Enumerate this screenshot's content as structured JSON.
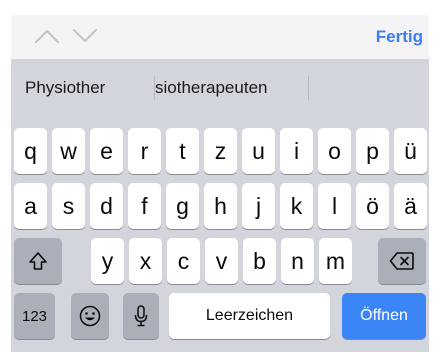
{
  "toolbar": {
    "prev_icon": "chevron-up-icon",
    "next_icon": "chevron-down-icon",
    "done_label": "Fertig",
    "accent_color": "#3b7df3"
  },
  "suggestions": {
    "items": [
      "Physiother",
      "siotherapeuten",
      ""
    ]
  },
  "keyboard": {
    "row1": [
      "q",
      "w",
      "e",
      "r",
      "t",
      "z",
      "u",
      "i",
      "o",
      "p",
      "ü"
    ],
    "row2": [
      "a",
      "s",
      "d",
      "f",
      "g",
      "h",
      "j",
      "k",
      "l",
      "ö",
      "ä"
    ],
    "row3": [
      "y",
      "x",
      "c",
      "v",
      "b",
      "n",
      "m"
    ],
    "shift_icon": "shift-icon",
    "backspace_icon": "backspace-icon",
    "numbers_label": "123",
    "emoji_icon": "emoji-icon",
    "mic_icon": "microphone-icon",
    "space_label": "Leerzeichen",
    "return_label": "Öffnen",
    "return_color": "#3b85f6"
  }
}
